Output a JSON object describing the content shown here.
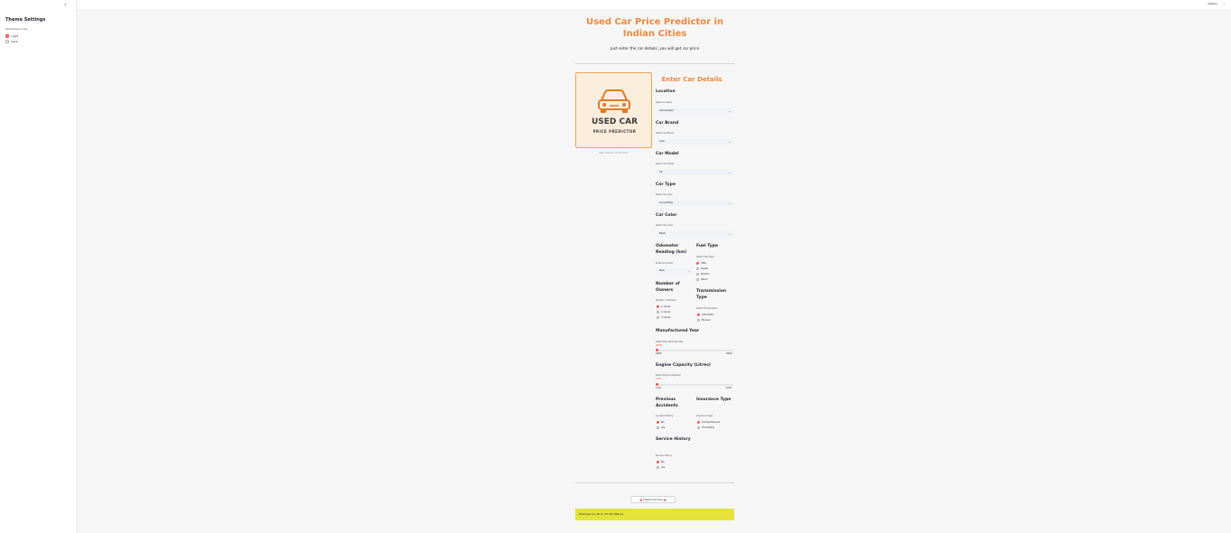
{
  "sidebar": {
    "collapse_icon": "chevron-left-icon",
    "title": "Theme Settings",
    "radio_label": "Select theme mode",
    "options": [
      {
        "label": "Light",
        "selected": true
      },
      {
        "label": "Dark",
        "selected": false
      }
    ]
  },
  "topbar": {
    "deploy": "Deploy",
    "menu": "⋮"
  },
  "header": {
    "title": "Used Car Price Predictor in Indian Cities",
    "subtitle": "Just enter the car details, you will get car price"
  },
  "logo": {
    "icon": "car-icon",
    "line1": "USED CAR",
    "line2": "PRICE PREDICTOR",
    "caption": "Used Vehicle Car Emulator"
  },
  "form": {
    "title": "Enter Car Details",
    "location": {
      "heading": "Location",
      "label": "Select Location",
      "value": "Ahmedabad"
    },
    "brand": {
      "heading": "Car Brand",
      "label": "Select Car Brand",
      "value": "Audi"
    },
    "model": {
      "heading": "Car Model",
      "label": "Select Car Model",
      "value": "A3"
    },
    "type": {
      "heading": "Car Type",
      "label": "Select Car Type",
      "value": "Convertible"
    },
    "color": {
      "heading": "Car Color",
      "label": "Select Car Color",
      "value": "Black"
    },
    "odometer": {
      "heading": "Odometer Reading (km)",
      "label": "Enter km driven",
      "value": "New"
    },
    "fuel": {
      "heading": "Fuel Type",
      "label": "Select Fuel Type",
      "options": [
        "CNG",
        "Diesel",
        "Electric",
        "Petrol"
      ],
      "selected": 0
    },
    "owners": {
      "heading": "Number of Owners",
      "label": "Number of Owners",
      "options": [
        "1 owner",
        "2 owner",
        "3 owner"
      ],
      "selected": 0
    },
    "transmission": {
      "heading": "Transmission Type",
      "label": "Select Transmission",
      "options": [
        "Automatic",
        "Manual"
      ],
      "selected": 0
    },
    "year": {
      "heading": "Manufactured Year",
      "label": "Select Manufactured Year",
      "value": "2000",
      "min": "2000",
      "max": "2024",
      "fraction": 0.0
    },
    "engine": {
      "heading": "Engine Capacity (Litres)",
      "label": "Select Engine Capacity",
      "value": "1.00",
      "min": "1.00",
      "max": "6.00",
      "fraction": 0.0
    },
    "accidents": {
      "heading": "Previous Accidents",
      "label": "Accident History",
      "options": [
        "No",
        "Yes"
      ],
      "selected": 0
    },
    "insurance": {
      "heading": "Insurance Type",
      "label": "Insurance Type",
      "options": [
        "Comprehensive",
        "Third Party"
      ],
      "selected": 0
    },
    "service": {
      "heading": "Service History",
      "label": "Service History",
      "options": [
        "No",
        "Yes"
      ],
      "selected": 0
    }
  },
  "predict_button": "🚗 Predict Car Price 🚗",
  "result": "Predicted Car Price: ₹3,797,964.44",
  "colors": {
    "accent": "#f0883e",
    "radio": "#ff4b4b",
    "result_bg": "#e5e33a"
  }
}
